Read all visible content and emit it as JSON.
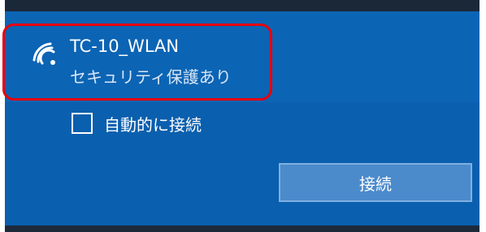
{
  "network": {
    "ssid": "TC-10_WLAN",
    "security": "セキュリティ保護あり",
    "icon": "wifi-secured-icon"
  },
  "auto_connect": {
    "label": "自動的に接続",
    "checked": false
  },
  "connect_button": {
    "label": "接続"
  },
  "colors": {
    "panel_background": "#0a5fae",
    "selected_item_background": "#0c64b4",
    "button_background": "#4b8bcc",
    "highlight_outline": "#e8000c"
  }
}
